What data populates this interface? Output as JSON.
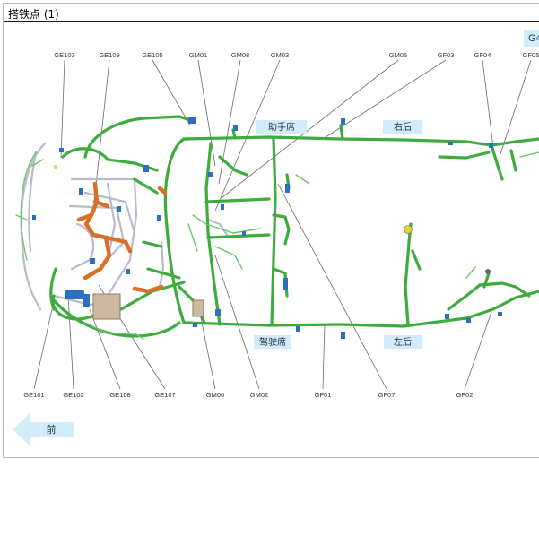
{
  "window": {
    "title": "搭铁点 (1)",
    "corner_tag": "G4"
  },
  "zones": {
    "passenger": "助手席",
    "right_rear": "右后",
    "driver": "驾驶席",
    "left_rear": "左后"
  },
  "direction": {
    "label": "前"
  },
  "top_labels": [
    "GE103",
    "GE109",
    "GE105",
    "GM01",
    "GM08",
    "GM03",
    "GM05",
    "GF03",
    "GF04",
    "GF05"
  ],
  "bottom_labels": [
    "GE101",
    "GE102",
    "GE108",
    "GE107",
    "GM06",
    "GM02",
    "GF01",
    "GF07",
    "GF02"
  ],
  "colors": {
    "harness_green": "#3dab3d",
    "harness_orange": "#d9702a",
    "harness_grey": "#b7bac9",
    "connector_blue": "#2f6fbf",
    "label_bg": "#d3ecf9",
    "leader_grey": "#6a6a6a"
  }
}
